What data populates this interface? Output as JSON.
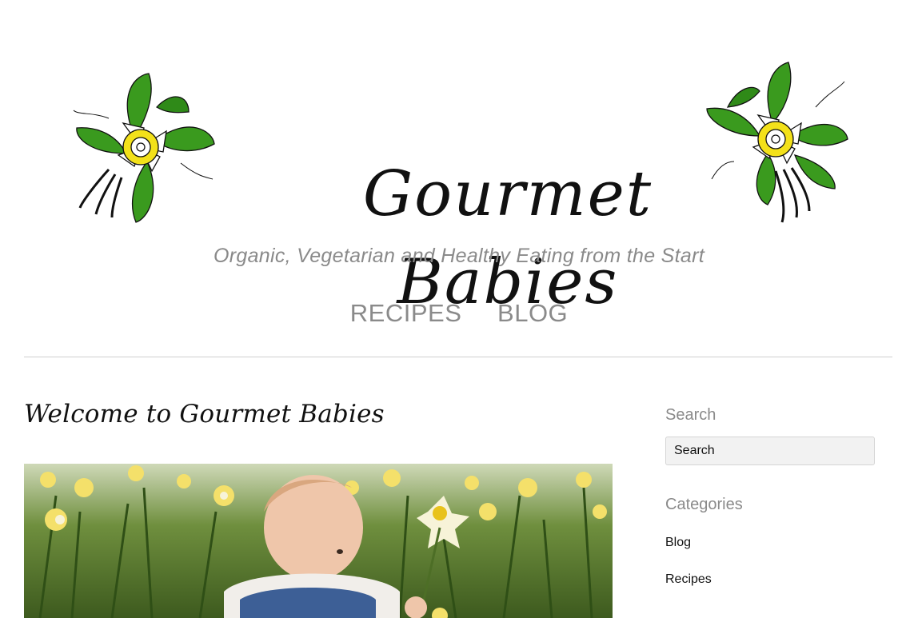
{
  "header": {
    "title": "Gourmet Babies",
    "tagline": "Organic, Vegetarian and Healthy Eating from the Start"
  },
  "nav": {
    "items": [
      {
        "label": "RECIPES"
      },
      {
        "label": "BLOG"
      }
    ]
  },
  "post": {
    "title": "Welcome to Gourmet Babies"
  },
  "sidebar": {
    "search_title": "Search",
    "search_placeholder": "Search",
    "categories_title": "Categories",
    "categories": [
      {
        "label": "Blog"
      },
      {
        "label": "Recipes"
      }
    ]
  },
  "colors": {
    "leaf_green": "#3a9a1e",
    "flower_yellow": "#f3e11a",
    "muted_text": "#8a8a8a",
    "divider": "#cfcfcf"
  }
}
